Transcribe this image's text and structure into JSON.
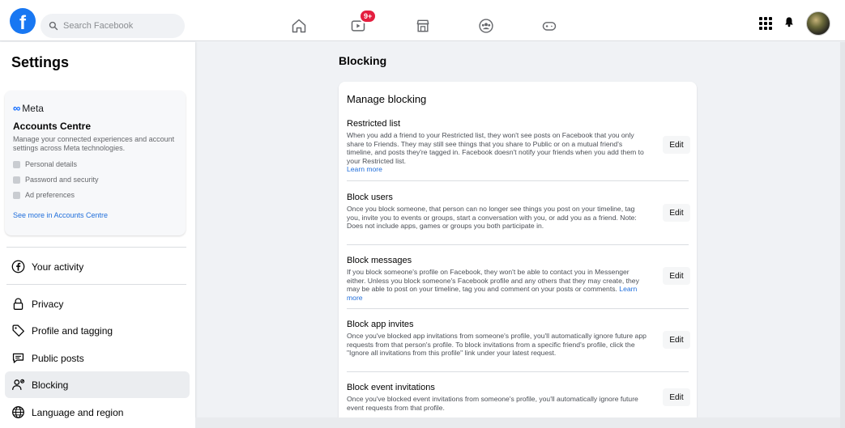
{
  "topbar": {
    "search_placeholder": "Search Facebook",
    "video_badge": "9+",
    "nav_icons": [
      "home-icon",
      "video-icon",
      "marketplace-icon",
      "groups-icon",
      "gaming-icon"
    ]
  },
  "sidebar": {
    "title": "Settings",
    "accounts_centre": {
      "meta_label": "Meta",
      "title": "Accounts Centre",
      "description": "Manage your connected experiences and account settings across Meta technologies.",
      "items": [
        "Personal details",
        "Password and security",
        "Ad preferences"
      ],
      "link": "See more in Accounts Centre"
    },
    "items": [
      {
        "label": "Your activity",
        "icon": "facebook-circle-icon"
      },
      {
        "label": "Privacy",
        "icon": "lock-icon"
      },
      {
        "label": "Profile and tagging",
        "icon": "tag-icon"
      },
      {
        "label": "Public posts",
        "icon": "public-posts-icon"
      },
      {
        "label": "Blocking",
        "icon": "blocking-icon",
        "active": true
      },
      {
        "label": "Language and region",
        "icon": "globe-icon"
      }
    ]
  },
  "main": {
    "title": "Blocking",
    "card_title": "Manage blocking",
    "edit_label": "Edit",
    "learn_more": "Learn more",
    "sections": [
      {
        "title": "Restricted list",
        "text": "When you add a friend to your Restricted list, they won't see posts on Facebook that you only share to Friends. They may still see things that you share to Public or on a mutual friend's timeline, and posts they're tagged in. Facebook doesn't notify your friends when you add them to your Restricted list."
      },
      {
        "title": "Block users",
        "text": "Once you block someone, that person can no longer see things you post on your timeline, tag you, invite you to events or groups, start a conversation with you, or add you as a friend. Note: Does not include apps, games or groups you both participate in."
      },
      {
        "title": "Block messages",
        "text": "If you block someone's profile on Facebook, they won't be able to contact you in Messenger either. Unless you block someone's Facebook profile and any others that they may create, they may be able to post on your timeline, tag you and comment on your posts or comments."
      },
      {
        "title": "Block app invites",
        "text": "Once you've blocked app invitations from someone's profile, you'll automatically ignore future app requests from that person's profile. To block invitations from a specific friend's profile, click the \"Ignore all invitations from this profile\" link under your latest request."
      },
      {
        "title": "Block event invitations",
        "text": "Once you've blocked event invitations from someone's profile, you'll automatically ignore future event requests from that profile."
      }
    ]
  }
}
